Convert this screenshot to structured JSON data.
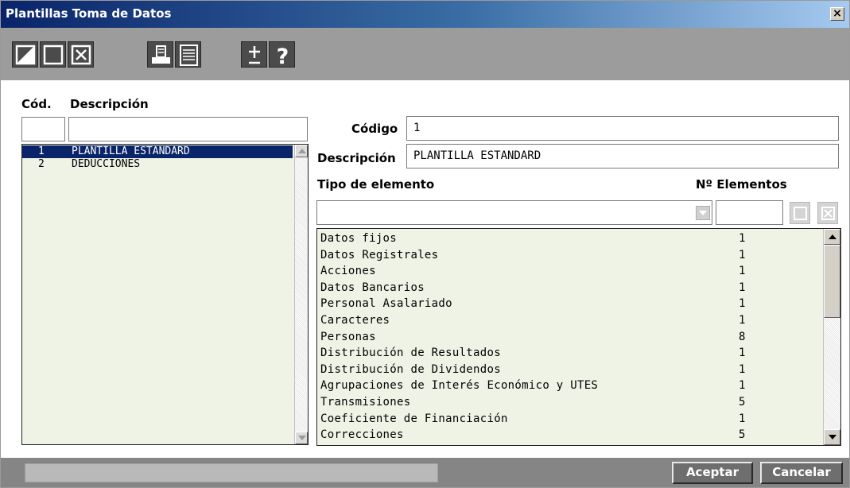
{
  "window": {
    "title": "Plantillas Toma de Datos",
    "close_glyph": "×"
  },
  "toolbar": {
    "buttons": [
      {
        "name": "edit-icon"
      },
      {
        "name": "new-icon"
      },
      {
        "name": "delete-icon"
      },
      {
        "name": "print-icon"
      },
      {
        "name": "list-icon"
      },
      {
        "name": "plus-minus-icon",
        "glyph": "±"
      },
      {
        "name": "help-icon",
        "glyph": "?"
      }
    ]
  },
  "left": {
    "col_code": "Cód.",
    "col_desc": "Descripción",
    "filter_code": "",
    "filter_desc": "",
    "items": [
      {
        "code": "1",
        "desc": "PLANTILLA ESTANDARD",
        "selected": true
      },
      {
        "code": "2",
        "desc": "DEDUCCIONES",
        "selected": false
      }
    ]
  },
  "form": {
    "codigo_label": "Código",
    "codigo_value": "1",
    "descripcion_label": "Descripción",
    "descripcion_value": "PLANTILLA ESTANDARD",
    "tipo_label": "Tipo de elemento",
    "num_label": "Nº Elementos",
    "tipo_value": "",
    "num_value": ""
  },
  "elements": [
    {
      "name": "Datos fijos",
      "count": "1"
    },
    {
      "name": "Datos Registrales",
      "count": "1"
    },
    {
      "name": "Acciones",
      "count": "1"
    },
    {
      "name": "Datos Bancarios",
      "count": "1"
    },
    {
      "name": "Personal Asalariado",
      "count": "1"
    },
    {
      "name": "Caracteres",
      "count": "1"
    },
    {
      "name": "Personas",
      "count": "8"
    },
    {
      "name": "Distribución de Resultados",
      "count": "1"
    },
    {
      "name": "Distribución de Dividendos",
      "count": "1"
    },
    {
      "name": "Agrupaciones de Interés Económico y UTES",
      "count": "1"
    },
    {
      "name": "Transmisiones",
      "count": "5"
    },
    {
      "name": "Coeficiente de Financiación",
      "count": "1"
    },
    {
      "name": "Correcciones",
      "count": "5"
    }
  ],
  "footer": {
    "accept": "Aceptar",
    "cancel": "Cancelar",
    "status": ""
  },
  "colors": {
    "title_start": "#0a246a",
    "selection": "#0a246a",
    "list_bg": "#eef3e6",
    "toolbar_bg": "#9c9c9c"
  }
}
